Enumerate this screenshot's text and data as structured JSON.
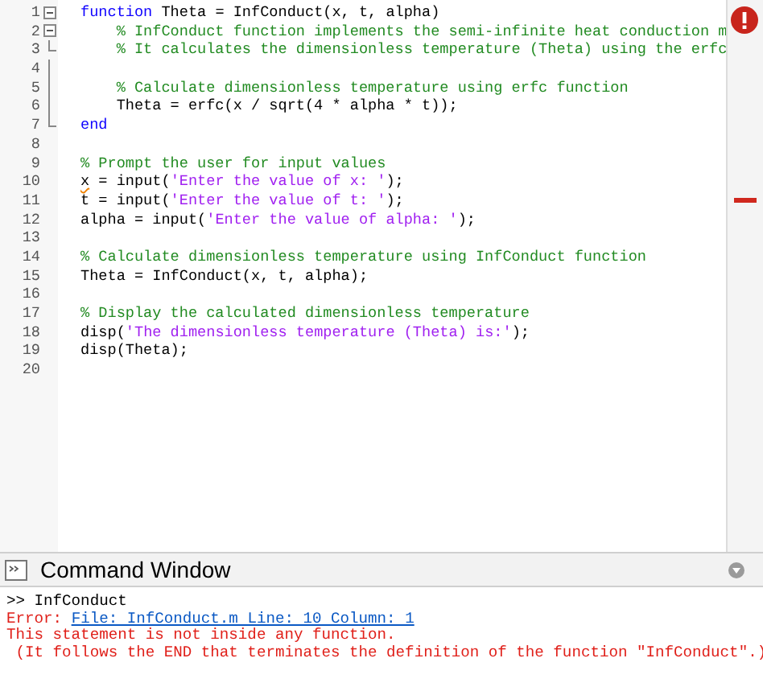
{
  "editor": {
    "has_error": true,
    "lines": [
      {
        "number": "1",
        "kind": "foldstart",
        "segments": [
          {
            "kind": "keyword",
            "text": "function"
          },
          {
            "kind": "plain",
            "text": " Theta = InfConduct(x, t, alpha)"
          }
        ]
      },
      {
        "number": "2",
        "kind": "foldstart",
        "segments": [
          {
            "kind": "comment",
            "text": "    % InfConduct function implements the semi-infinite heat conduction m"
          }
        ]
      },
      {
        "number": "3",
        "kind": "foldend",
        "segments": [
          {
            "kind": "comment",
            "text": "    % It calculates the dimensionless temperature (Theta) using the erfc"
          }
        ]
      },
      {
        "number": "4",
        "kind": "foldbody"
      },
      {
        "number": "5",
        "kind": "foldbody",
        "segments": [
          {
            "kind": "comment",
            "text": "    % Calculate dimensionless temperature using erfc function"
          }
        ]
      },
      {
        "number": "6",
        "kind": "foldbody",
        "segments": [
          {
            "kind": "plain",
            "text": "    Theta = erfc(x / sqrt(4 * alpha * t));"
          }
        ]
      },
      {
        "number": "7",
        "kind": "foldend",
        "segments": [
          {
            "kind": "keyword",
            "text": "end"
          }
        ]
      },
      {
        "number": "8",
        "kind": "plain"
      },
      {
        "number": "9",
        "kind": "plain",
        "segments": [
          {
            "kind": "comment",
            "text": "% Prompt the user for input values"
          }
        ]
      },
      {
        "number": "10",
        "kind": "plain",
        "segments": [
          {
            "kind": "warning",
            "text": "x"
          },
          {
            "kind": "plain",
            "text": " = input("
          },
          {
            "kind": "string",
            "text": "'Enter the value of x: '"
          },
          {
            "kind": "plain",
            "text": ");"
          }
        ]
      },
      {
        "number": "11",
        "kind": "plain",
        "marker": true,
        "segments": [
          {
            "kind": "plain",
            "text": "t = input("
          },
          {
            "kind": "string",
            "text": "'Enter the value of t: '"
          },
          {
            "kind": "plain",
            "text": ");"
          }
        ]
      },
      {
        "number": "12",
        "kind": "plain",
        "segments": [
          {
            "kind": "plain",
            "text": "alpha = input("
          },
          {
            "kind": "string",
            "text": "'Enter the value of alpha: '"
          },
          {
            "kind": "plain",
            "text": ");"
          }
        ]
      },
      {
        "number": "13",
        "kind": "plain"
      },
      {
        "number": "14",
        "kind": "plain",
        "segments": [
          {
            "kind": "comment",
            "text": "% Calculate dimensionless temperature using InfConduct function"
          }
        ]
      },
      {
        "number": "15",
        "kind": "plain",
        "segments": [
          {
            "kind": "plain",
            "text": "Theta = InfConduct(x, t, alpha);"
          }
        ]
      },
      {
        "number": "16",
        "kind": "plain"
      },
      {
        "number": "17",
        "kind": "plain",
        "segments": [
          {
            "kind": "comment",
            "text": "% Display the calculated dimensionless temperature"
          }
        ]
      },
      {
        "number": "18",
        "kind": "plain",
        "segments": [
          {
            "kind": "plain",
            "text": "disp("
          },
          {
            "kind": "string",
            "text": "'The dimensionless temperature (Theta) is:'"
          },
          {
            "kind": "plain",
            "text": ");"
          }
        ]
      },
      {
        "number": "19",
        "kind": "plain",
        "segments": [
          {
            "kind": "plain",
            "text": "disp(Theta);"
          }
        ]
      },
      {
        "number": "20",
        "kind": "plain"
      }
    ]
  },
  "command_window": {
    "title": "Command Window",
    "lines": [
      {
        "kind": "input",
        "text": ">> InfConduct"
      },
      {
        "kind": "error",
        "text": "Error: ",
        "link": "File: InfConduct.m Line: 10 Column: 1"
      },
      {
        "kind": "error",
        "text": "This statement is not inside any function."
      },
      {
        "kind": "error",
        "text": " (It follows the END that terminates the definition of the function \"InfConduct\".)"
      }
    ]
  }
}
